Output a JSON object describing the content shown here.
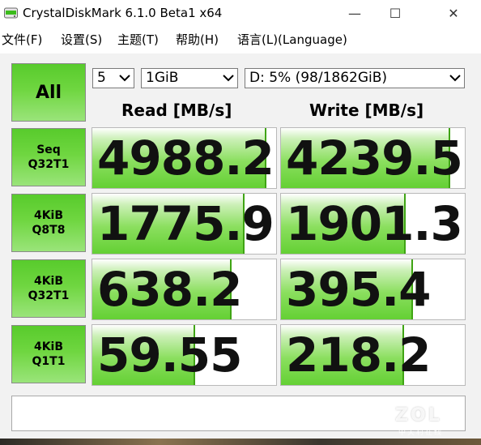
{
  "window": {
    "title": "CrystalDiskMark 6.1.0 Beta1 x64",
    "controls": {
      "minimize": "—",
      "maximize": "☐",
      "close": "✕"
    }
  },
  "menu": [
    {
      "label": "文件(F)"
    },
    {
      "label": "设置(S)"
    },
    {
      "label": "主题(T)"
    },
    {
      "label": "帮助(H)"
    },
    {
      "label": "语言(L)(Language)"
    }
  ],
  "controls": {
    "all_label": "All",
    "count": "5",
    "size": "1GiB",
    "drive": "D: 5% (98/1862GiB)"
  },
  "headers": {
    "read": "Read [MB/s]",
    "write": "Write [MB/s]"
  },
  "tests": [
    {
      "line1": "Seq",
      "line2": "Q32T1",
      "read": "4988.2",
      "write": "4239.5",
      "read_fill": 0.94,
      "write_fill": 0.91
    },
    {
      "line1": "4KiB",
      "line2": "Q8T8",
      "read": "1775.9",
      "write": "1901.3",
      "read_fill": 0.82,
      "write_fill": 0.67
    },
    {
      "line1": "4KiB",
      "line2": "Q32T1",
      "read": "638.2",
      "write": "395.4",
      "read_fill": 0.75,
      "write_fill": 0.71
    },
    {
      "line1": "4KiB",
      "line2": "Q1T1",
      "read": "59.55",
      "write": "218.2",
      "read_fill": 0.55,
      "write_fill": 0.66
    }
  ],
  "comment": "",
  "watermark": {
    "text": "ZOL",
    "sub": "中关村在线"
  },
  "colors": {
    "accent": "#6fd640",
    "bar": "#64d034",
    "border": "#8a8a8a"
  }
}
